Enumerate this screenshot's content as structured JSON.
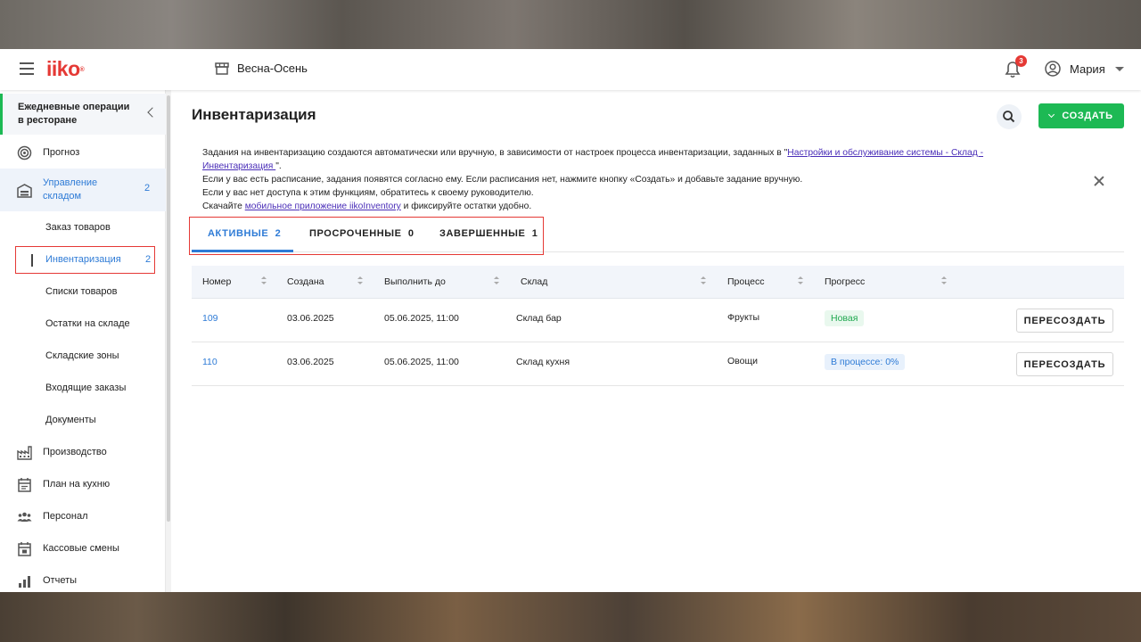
{
  "header": {
    "logo": "iiko",
    "logo_mark": "®",
    "store_name": "Весна-Осень",
    "notification_count": "3",
    "user_name": "Мария"
  },
  "sidebar": {
    "section_title": "Ежедневные операции в ресторане",
    "items": [
      {
        "label": "Прогноз",
        "icon": "target-icon"
      },
      {
        "label": "Управление складом",
        "icon": "warehouse-icon",
        "count": "2"
      },
      {
        "label": "Заказ товаров"
      },
      {
        "label": "Инвентаризация",
        "count": "2"
      },
      {
        "label": "Списки товаров"
      },
      {
        "label": "Остатки на складе"
      },
      {
        "label": "Складские зоны"
      },
      {
        "label": "Входящие заказы"
      },
      {
        "label": "Документы"
      },
      {
        "label": "Производство",
        "icon": "factory-icon"
      },
      {
        "label": "План на кухню",
        "icon": "calendar-icon"
      },
      {
        "label": "Персонал",
        "icon": "people-icon"
      },
      {
        "label": "Кассовые смены",
        "icon": "calendar-check-icon"
      },
      {
        "label": "Отчеты",
        "icon": "bar-chart-icon"
      }
    ]
  },
  "main": {
    "title": "Инвентаризация",
    "create_label": "СОЗДАТЬ",
    "info": {
      "line1_before": "Задания на инвентаризацию создаются автоматически или вручную, в зависимости от настроек процесса инвентаризации, заданных в \"",
      "line1_link": "Настройки и обслуживание системы - Склад - Инвентаризация ",
      "line1_after": "\".",
      "line2": "Если у вас есть расписание, задания появятся согласно ему. Если расписания нет, нажмите кнопку «Создать» и добавьте задание вручную.",
      "line3": "Если у вас нет доступа к этим функциям, обратитесь к своему руководителю.",
      "line4_before": "Скачайте ",
      "line4_link": "мобильное приложение iikoInventory",
      "line4_after": " и фиксируйте остатки удобно."
    },
    "tabs": [
      {
        "label": "АКТИВНЫЕ",
        "count": "2"
      },
      {
        "label": "ПРОСРОЧЕННЫЕ",
        "count": "0"
      },
      {
        "label": "ЗАВЕРШЕННЫЕ",
        "count": "1"
      }
    ],
    "columns": [
      "Номер",
      "Создана",
      "Выполнить до",
      "Склад",
      "Процесс",
      "Прогресс"
    ],
    "rows": [
      {
        "number": "109",
        "created": "03.06.2025",
        "due": "05.06.2025, 11:00",
        "warehouse": "Склад бар",
        "process": "Фрукты",
        "progress": "Новая",
        "action": "ПЕРЕСОЗДАТЬ"
      },
      {
        "number": "110",
        "created": "03.06.2025",
        "due": "05.06.2025, 11:00",
        "warehouse": "Склад кухня",
        "process": "Овощи",
        "progress": "В процессе: 0%",
        "action": "ПЕРЕСОЗДАТЬ"
      }
    ]
  },
  "colors": {
    "brand_red": "#e53935",
    "accent_green": "#1db954",
    "link_blue": "#2e7bd6"
  }
}
